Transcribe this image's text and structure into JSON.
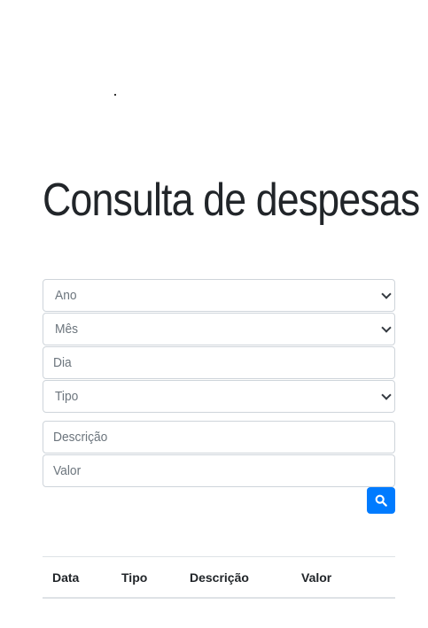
{
  "page": {
    "title": "Consulta de despesas"
  },
  "form": {
    "ano": {
      "value": "Ano"
    },
    "mes": {
      "value": "Mês"
    },
    "dia": {
      "placeholder": "Dia"
    },
    "tipo": {
      "value": "Tipo"
    },
    "descricao": {
      "placeholder": "Descrição"
    },
    "valor": {
      "placeholder": "Valor"
    },
    "search_button_icon": "search-icon"
  },
  "table": {
    "headers": [
      "Data",
      "Tipo",
      "Descrição",
      "Valor"
    ],
    "rows": []
  },
  "colors": {
    "accent": "#007bff",
    "border": "#ced4da",
    "placeholder": "#6c757d",
    "text": "#212529"
  }
}
